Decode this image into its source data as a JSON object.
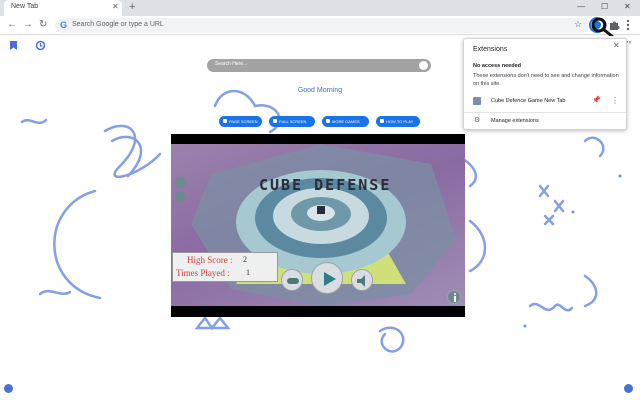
{
  "tab": {
    "title": "New Tab",
    "close_glyph": "✕",
    "new_tab_glyph": "+"
  },
  "window_controls": {
    "minimize": "—",
    "maximize": "☐",
    "close": "✕"
  },
  "toolbar": {
    "back_glyph": "←",
    "forward_glyph": "→",
    "reload_glyph": "↻",
    "omnibox_placeholder": "Search Google or type a URL",
    "omnibox_icon": "G",
    "star_glyph": "☆"
  },
  "page": {
    "search_placeholder": "Search Here...",
    "greeting": "Good Morning",
    "buttons": [
      "PAGE SCREEN",
      "FULL SCREEN",
      "MORE GAMES",
      "HOW TO PLAY"
    ],
    "weather_fragment": "7°"
  },
  "game": {
    "title": "CUBE DEFENSE",
    "high_score_label": "High Score :",
    "high_score_value": "2",
    "times_played_label": "Times Played :",
    "times_played_value": "1"
  },
  "extensions_popup": {
    "title": "Extensions",
    "close_glyph": "✕",
    "heading": "No access needed",
    "description": "These extensions don't need to see and change information on this site.",
    "items": [
      {
        "label": "Cube Defence Game New Tab",
        "icon": "puzzle-cube-icon",
        "pinned": true
      }
    ],
    "more_glyph": "⋮",
    "pin_glyph": "📌",
    "manage_label": "Manage extensions",
    "manage_glyph": "⚙"
  },
  "colors": {
    "accent": "#1a73e8",
    "doodle_blue": "#6f8ee6",
    "game_purple": "#8a6aa2",
    "score_red": "#d63a3a"
  }
}
